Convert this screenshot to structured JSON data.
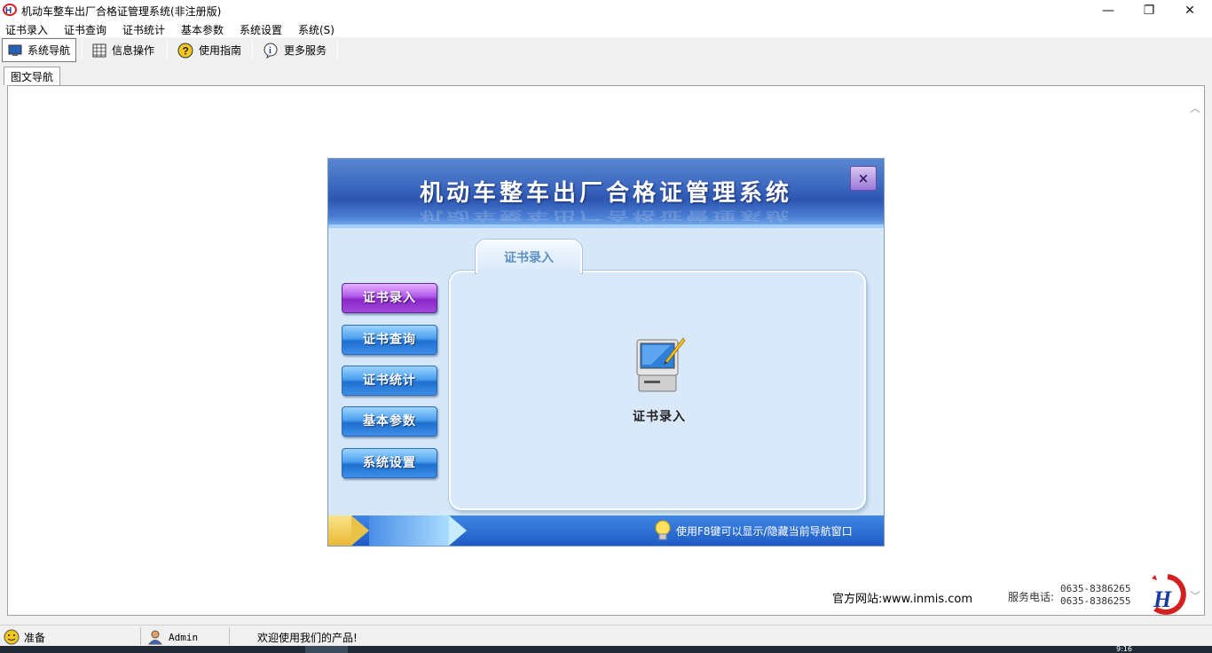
{
  "window": {
    "title": "机动车整车出厂合格证管理系统(非注册版)",
    "minimize": "—",
    "restore": "❐",
    "close": "✕"
  },
  "menu": [
    "证书录入",
    "证书查询",
    "证书统计",
    "基本参数",
    "系统设置",
    "系统(S)"
  ],
  "toolbar": {
    "nav": "系统导航",
    "info": "信息操作",
    "guide": "使用指南",
    "more": "更多服务"
  },
  "tabs": {
    "active": "图文导航"
  },
  "nav_panel": {
    "title": "机动车整车出厂合格证管理系统",
    "close": "×",
    "content_tab": "证书录入",
    "content_item": "证书录入",
    "side_buttons": [
      "证书录入",
      "证书查询",
      "证书统计",
      "基本参数",
      "系统设置"
    ],
    "active_index": 0,
    "hint": "使用F8键可以显示/隐藏当前导航窗口"
  },
  "footer": {
    "website": "官方网站:www.inmis.com",
    "phone_label": "服务电话:",
    "phones": [
      "0635-8386265",
      "0635-8386255"
    ]
  },
  "status": {
    "ready": "准备",
    "user": "Admin",
    "welcome": "欢迎使用我们的产品!"
  },
  "taskbar": {
    "clock_fragment": "9:16"
  },
  "colors": {
    "header_blue": "#2c56b0",
    "active_purple": "#8a28c8",
    "button_blue": "#1e6fd0",
    "panel_bg": "#d6e8f8"
  }
}
